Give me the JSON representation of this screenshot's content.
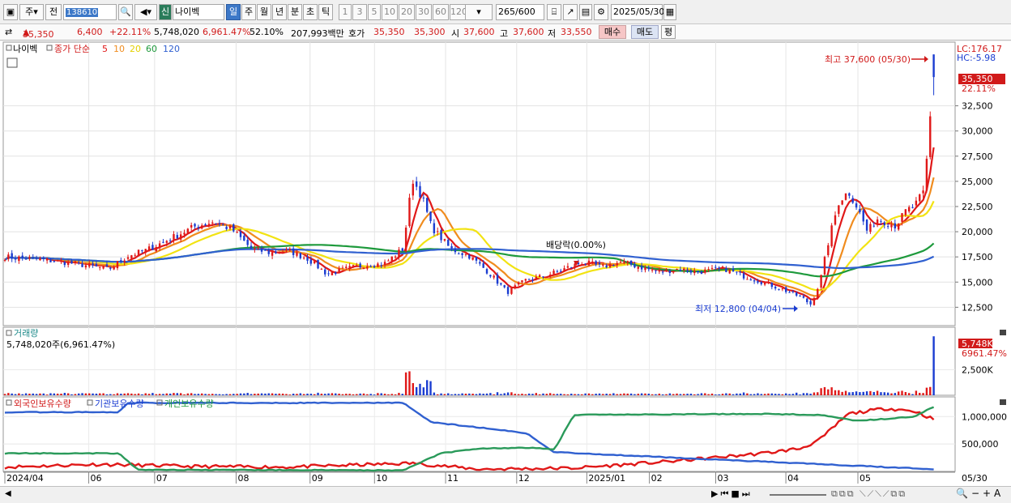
{
  "toolbar": {
    "type_label": "주",
    "prev_label": "전",
    "code": "138610",
    "name_badge": "신",
    "stock_name": "나이벡",
    "periods": [
      "일",
      "주",
      "월",
      "년",
      "분",
      "초",
      "틱"
    ],
    "active_period": "일",
    "minutes": [
      "1",
      "3",
      "5",
      "10",
      "20",
      "30",
      "60",
      "120"
    ],
    "count": "265",
    "count_total": "/600",
    "date": "2025/05/30"
  },
  "info": {
    "price": "35,350",
    "change": "6,400",
    "change_pct": "+22.11%",
    "volume": "5,748,020",
    "volume_pct": "6,961.47%",
    "turnover": "52.10%",
    "amount": "207,993백만",
    "quote_label": "호가",
    "ask": "35,350",
    "bid": "35,300",
    "open_label": "시",
    "open": "37,600",
    "high_label": "고",
    "high": "37,600",
    "low_label": "저",
    "low": "33,550",
    "buy": "매수",
    "sell": "매도",
    "eval": "평"
  },
  "colors": {
    "up": "#e01818",
    "down": "#1a3cd1",
    "ma5": "#e01818",
    "ma10": "#f08c1e",
    "ma20": "#f2e312",
    "ma60": "#1e9a3c",
    "ma120": "#3060d0"
  },
  "price_panel": {
    "legend_name": "나이벡",
    "legend_title": "종가 단순",
    "ma_labels": [
      "5",
      "10",
      "20",
      "60",
      "120"
    ],
    "lc": "LC:176.17",
    "hc": "HC:-5.98",
    "high_marker": "최고 37,600 (05/30)",
    "low_marker": "최저 12,800 (04/04)",
    "dividend_marker": "배당락(0.00%)",
    "price_tag": "35,350",
    "pct_tag": "22.11%",
    "y_ticks": [
      "32,500",
      "30,000",
      "27,500",
      "25,000",
      "22,500",
      "20,000",
      "17,500",
      "15,000",
      "12,500"
    ]
  },
  "volume_panel": {
    "title": "거래량",
    "readout": "5,748,020주(6,961.47%)",
    "tag_value": "5,748K",
    "tag_pct": "6961.47%",
    "y_tick": "2,500K"
  },
  "holdings_panel": {
    "legend": [
      "외국인보유수량",
      "기관보유수량",
      "개인보유수량"
    ],
    "y_ticks": [
      "1,000,000",
      "500,000"
    ]
  },
  "x_axis": {
    "labels": [
      "2024/04",
      "06",
      "07",
      "08",
      "09",
      "10",
      "11",
      "12",
      "2025/01",
      "02",
      "03",
      "04",
      "05"
    ],
    "last": "05/30"
  },
  "chart_data": {
    "type": "candlestick",
    "x_range": [
      "2024/04",
      "2025/05/30"
    ],
    "price_ylim": [
      11000,
      38500
    ],
    "ohlc_summary": {
      "last_close": 35350,
      "period_high": {
        "value": 37600,
        "date": "05/30"
      },
      "period_low": {
        "value": 12800,
        "date": "04/04"
      }
    },
    "close_path": [
      [
        0,
        17500
      ],
      [
        0.03,
        17300
      ],
      [
        0.06,
        17000
      ],
      [
        0.09,
        16600
      ],
      [
        0.11,
        16300
      ],
      [
        0.13,
        17600
      ],
      [
        0.15,
        18200
      ],
      [
        0.17,
        19100
      ],
      [
        0.2,
        20500
      ],
      [
        0.22,
        21000
      ],
      [
        0.24,
        20200
      ],
      [
        0.26,
        18300
      ],
      [
        0.28,
        17900
      ],
      [
        0.3,
        18100
      ],
      [
        0.32,
        17300
      ],
      [
        0.34,
        15800
      ],
      [
        0.36,
        16300
      ],
      [
        0.38,
        16700
      ],
      [
        0.4,
        16800
      ],
      [
        0.42,
        18300
      ],
      [
        0.43,
        25200
      ],
      [
        0.44,
        23500
      ],
      [
        0.45,
        20500
      ],
      [
        0.47,
        18300
      ],
      [
        0.49,
        17600
      ],
      [
        0.51,
        16000
      ],
      [
        0.53,
        14000
      ],
      [
        0.55,
        15200
      ],
      [
        0.57,
        15600
      ],
      [
        0.59,
        16300
      ],
      [
        0.61,
        17000
      ],
      [
        0.63,
        16500
      ],
      [
        0.65,
        17000
      ],
      [
        0.67,
        16500
      ],
      [
        0.69,
        16000
      ],
      [
        0.71,
        16300
      ],
      [
        0.73,
        16000
      ],
      [
        0.76,
        16300
      ],
      [
        0.78,
        15600
      ],
      [
        0.8,
        15000
      ],
      [
        0.82,
        14300
      ],
      [
        0.84,
        13500
      ],
      [
        0.85,
        12800
      ],
      [
        0.86,
        15000
      ],
      [
        0.87,
        19500
      ],
      [
        0.88,
        23000
      ],
      [
        0.89,
        24000
      ],
      [
        0.9,
        22300
      ],
      [
        0.91,
        20000
      ],
      [
        0.92,
        21300
      ],
      [
        0.94,
        20600
      ],
      [
        0.95,
        22000
      ],
      [
        0.96,
        22600
      ],
      [
        0.97,
        24000
      ],
      [
        0.975,
        30000
      ],
      [
        0.98,
        35350
      ]
    ],
    "moving_averages": [
      "5",
      "10",
      "20",
      "60",
      "120"
    ],
    "volume_ylim": [
      0,
      6000000
    ],
    "volume_last": 5748020,
    "volume_yticks": [
      2500000
    ],
    "holdings_ylim": [
      0,
      1300000
    ],
    "holdings_yticks": [
      1000000,
      500000
    ],
    "holdings_series": [
      {
        "name": "외국인보유수량",
        "points": [
          [
            0,
            80000
          ],
          [
            0.1,
            130000
          ],
          [
            0.2,
            90000
          ],
          [
            0.3,
            80000
          ],
          [
            0.43,
            150000
          ],
          [
            0.5,
            40000
          ],
          [
            0.6,
            60000
          ],
          [
            0.7,
            180000
          ],
          [
            0.8,
            330000
          ],
          [
            0.84,
            420000
          ],
          [
            0.86,
            580000
          ],
          [
            0.89,
            1050000
          ],
          [
            0.93,
            1150000
          ],
          [
            0.96,
            1100000
          ],
          [
            0.98,
            950000
          ]
        ]
      },
      {
        "name": "기관보유수량",
        "points": [
          [
            0,
            1080000
          ],
          [
            0.12,
            1080000
          ],
          [
            0.13,
            1250000
          ],
          [
            0.42,
            1250000
          ],
          [
            0.45,
            900000
          ],
          [
            0.55,
            700000
          ],
          [
            0.58,
            350000
          ],
          [
            0.98,
            40000
          ]
        ]
      },
      {
        "name": "개인보유수량",
        "points": [
          [
            0,
            330000
          ],
          [
            0.12,
            330000
          ],
          [
            0.14,
            30000
          ],
          [
            0.42,
            20000
          ],
          [
            0.46,
            330000
          ],
          [
            0.5,
            420000
          ],
          [
            0.56,
            430000
          ],
          [
            0.58,
            400000
          ],
          [
            0.6,
            1030000
          ],
          [
            0.8,
            1050000
          ],
          [
            0.86,
            1030000
          ],
          [
            0.9,
            920000
          ],
          [
            0.96,
            1000000
          ],
          [
            0.98,
            1180000
          ]
        ]
      }
    ]
  }
}
